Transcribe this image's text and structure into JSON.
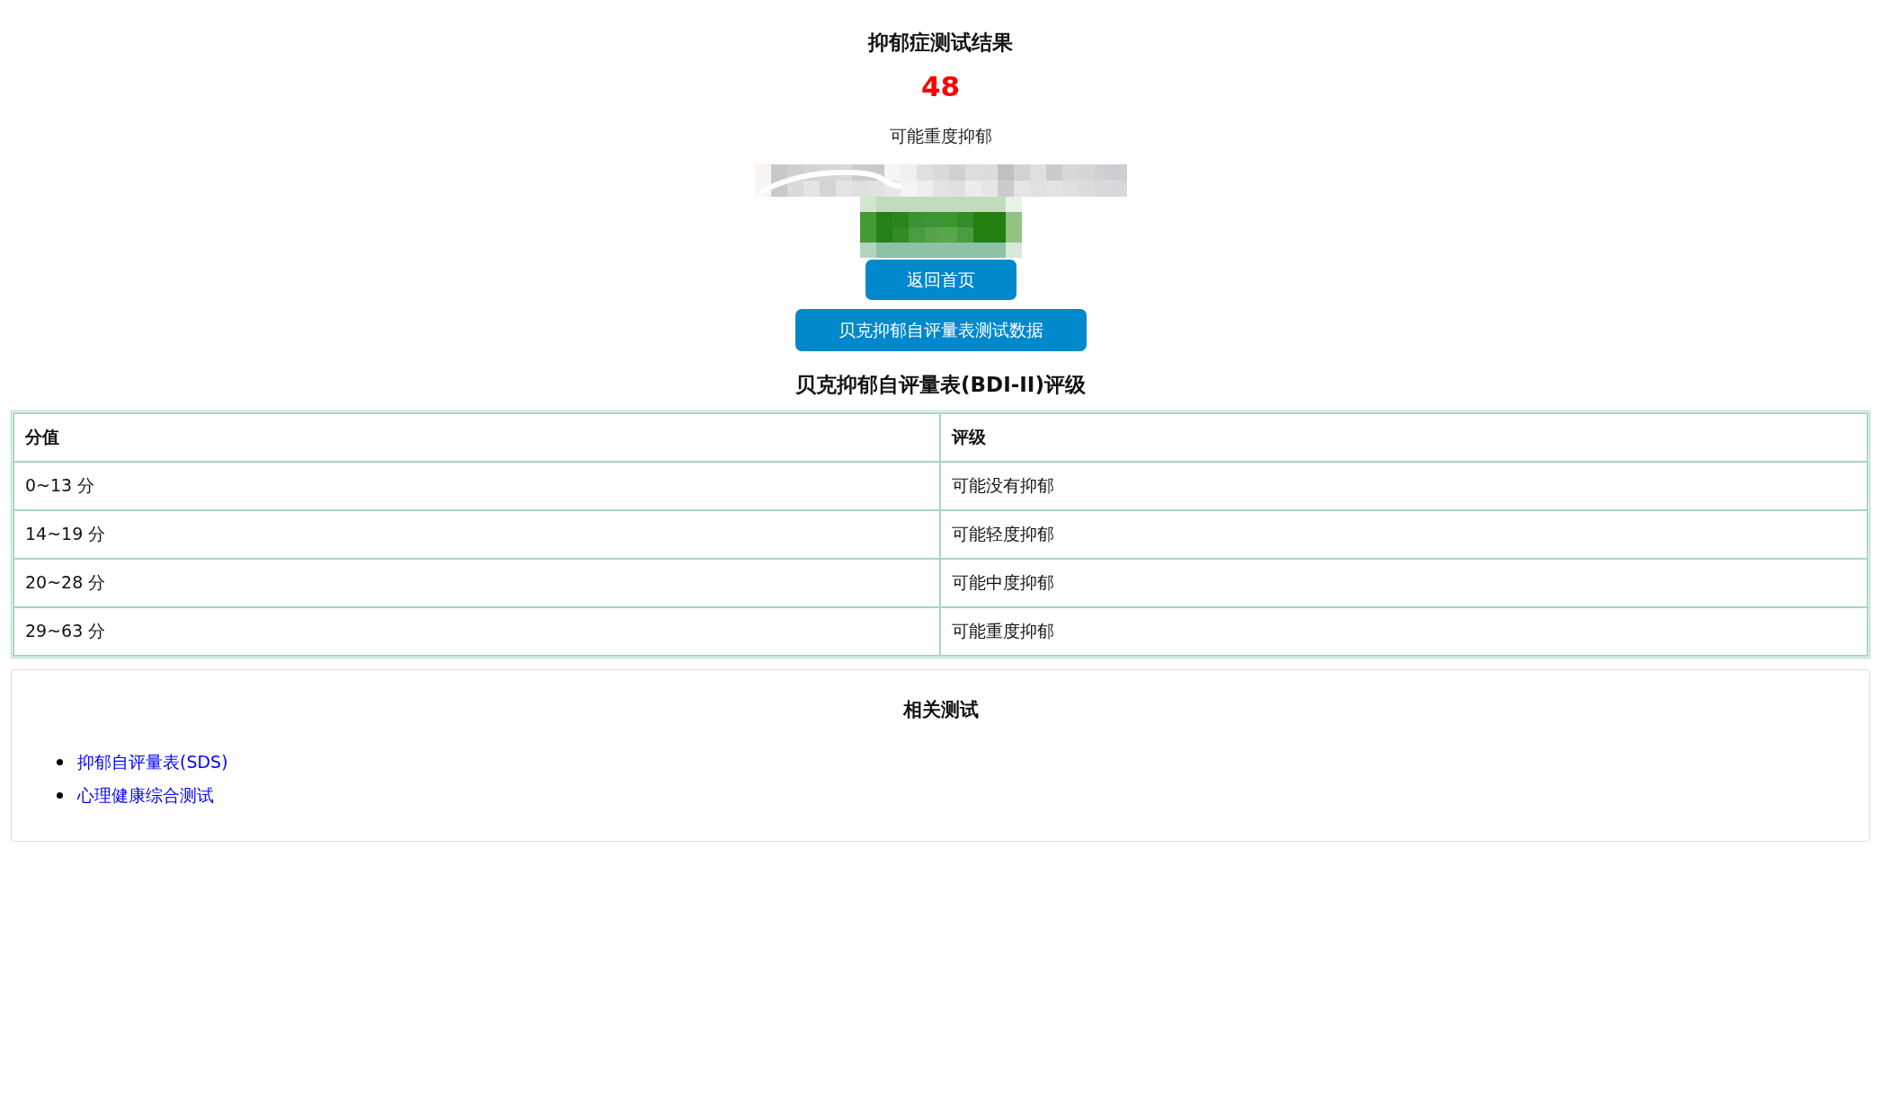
{
  "result": {
    "title": "抑郁症测试结果",
    "score": "48",
    "verdict": "可能重度抑郁"
  },
  "buttons": [
    "返回首页",
    "贝克抑郁自评量表测试数据"
  ],
  "rating_table": {
    "title": "贝克抑郁自评量表(BDI-II)评级",
    "columns": [
      "分值",
      "评级"
    ],
    "rows": [
      [
        "0~13 分",
        "可能没有抑郁"
      ],
      [
        "14~19 分",
        "可能轻度抑郁"
      ],
      [
        "20~28 分",
        "可能中度抑郁"
      ],
      [
        "29~63 分",
        "可能重度抑郁"
      ]
    ]
  },
  "related_tests": {
    "title": "相关测试",
    "links": [
      "抑郁自评量表(SDS)",
      "心理健康综合测试"
    ]
  }
}
